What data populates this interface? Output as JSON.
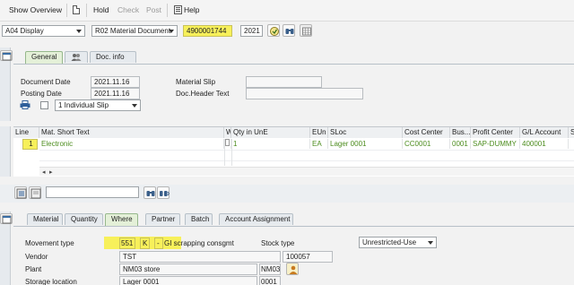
{
  "toolbar": {
    "show_overview": "Show Overview",
    "hold": "Hold",
    "check": "Check",
    "post": "Post",
    "help": "Help"
  },
  "header_fields": {
    "action": "A04 Display",
    "ref_doc_type": "R02 Material Document",
    "doc_number": "4900001744",
    "year": "2021"
  },
  "top_tabs": [
    {
      "label": "General",
      "active": true
    },
    {
      "label": "Doc. info",
      "active": false
    }
  ],
  "general": {
    "document_date_label": "Document Date",
    "document_date": "2021.11.16",
    "posting_date_label": "Posting Date",
    "posting_date": "2021.11.16",
    "material_slip_label": "Material Slip",
    "material_slip": "",
    "doc_header_text_label": "Doc.Header Text",
    "doc_header_text": "",
    "slip_option": "1 Individual Slip"
  },
  "table": {
    "columns": [
      "Line",
      "Mat. Short Text",
      "W",
      "Qty in UnE",
      "EUn",
      "SLoc",
      "Cost Center",
      "Bus...",
      "Profit Center",
      "G/L Account",
      "S"
    ],
    "rows": [
      {
        "line": "1",
        "text": "Electronic",
        "w": "",
        "qty": "1",
        "eun": "EA",
        "sloc": "Lager 0001",
        "cost_center": "CC0001",
        "bus": "0001",
        "profit_center": "SAP-DUMMY",
        "gl_account": "400001",
        "s": ""
      }
    ]
  },
  "detail_tabs": [
    {
      "label": "Material",
      "active": false
    },
    {
      "label": "Quantity",
      "active": false
    },
    {
      "label": "Where",
      "active": true
    },
    {
      "label": "Partner",
      "active": false
    },
    {
      "label": "Batch",
      "active": false
    },
    {
      "label": "Account Assignment",
      "active": false
    }
  ],
  "where": {
    "movement_type_label": "Movement type",
    "movement_type": "551",
    "movement_indicator": "K",
    "movement_dash": "-",
    "movement_desc": "GI scrapping consgmt",
    "stock_type_label": "Stock type",
    "stock_type": "Unrestricted-Use",
    "vendor_label": "Vendor",
    "vendor_name": "TST",
    "vendor_number": "100057",
    "plant_label": "Plant",
    "plant_name": "NM03 store",
    "plant_code": "NM03",
    "storage_location_label": "Storage location",
    "storage_location_name": "Lager 0001",
    "storage_location_code": "0001"
  },
  "colors": {
    "highlight": "#f7f05a",
    "active_tab": "#e4f0d8",
    "row_text": "#4d8d1f"
  }
}
